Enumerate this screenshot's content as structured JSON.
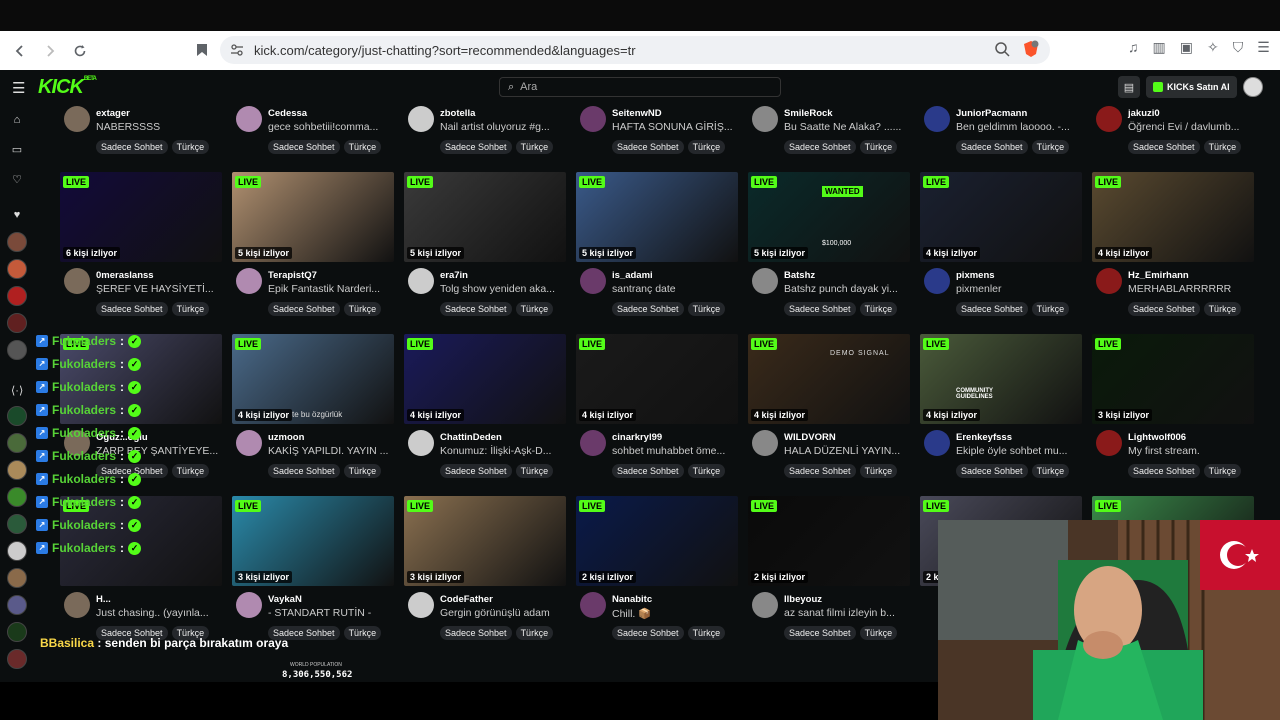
{
  "browser": {
    "url": "kick.com/category/just-chatting?sort=recommended&languages=tr",
    "back_icon": "arrow-left-icon",
    "forward_icon": "arrow-right-icon",
    "reload_icon": "reload-icon"
  },
  "header": {
    "logo": "KICK",
    "logo_badge": "BETA",
    "search_placeholder": "Ara",
    "buy_label": "KICKs Satın Al"
  },
  "tags": {
    "cat": "Sadece Sohbet",
    "lang": "Türkçe"
  },
  "live_label": "LIVE",
  "rows": [
    {
      "streams": [
        {
          "name": "extager",
          "title": "NABERSSSS",
          "viewers": ""
        },
        {
          "name": "Cedessa",
          "title": "gece sohbetiii!comma...",
          "viewers": ""
        },
        {
          "name": "zbotella",
          "title": "Nail artist oluyoruz #g...",
          "viewers": ""
        },
        {
          "name": "SeitenwND",
          "title": "HAFTA SONUNA GİRİŞ...",
          "viewers": ""
        },
        {
          "name": "SmileRock",
          "title": "Bu Saatte Ne Alaka? ......",
          "viewers": ""
        },
        {
          "name": "JuniorPacmann",
          "title": "Ben geldimm laoooo. -...",
          "viewers": ""
        },
        {
          "name": "jakuzi0",
          "title": "Öğrenci Evi / davlumb...",
          "viewers": ""
        }
      ]
    },
    {
      "streams": [
        {
          "name": "0meraslanss",
          "title": "ŞEREF VE HAYSİYETİ...",
          "viewers": "6 kişi izliyor"
        },
        {
          "name": "TerapistQ7",
          "title": "Epik Fantastik Narderi...",
          "viewers": "5 kişi izliyor"
        },
        {
          "name": "era7in",
          "title": "Tolg show yeniden aka...",
          "viewers": "5 kişi izliyor"
        },
        {
          "name": "is_adami",
          "title": "santranç date",
          "viewers": "5 kişi izliyor"
        },
        {
          "name": "Batshz",
          "title": "Batshz punch dayak yi...",
          "viewers": "5 kişi izliyor"
        },
        {
          "name": "pixmens",
          "title": "pixmenler",
          "viewers": "4 kişi izliyor"
        },
        {
          "name": "Hz_Emirhann",
          "title": "MERHABLARRRRRR",
          "viewers": "4 kişi izliyor"
        }
      ]
    },
    {
      "streams": [
        {
          "name": "Oguz...oglu",
          "title": "ZARP BEY ŞANTİYEYE...",
          "viewers": ""
        },
        {
          "name": "uzmoon",
          "title": "KAKİŞ YAPILDI. YAYIN ...",
          "viewers": "4 kişi izliyor"
        },
        {
          "name": "ChattinDeden",
          "title": "Konumuz: İlişki-Aşk-D...",
          "viewers": "4 kişi izliyor"
        },
        {
          "name": "cinarkryl99",
          "title": "sohbet muhabbet öme...",
          "viewers": "4 kişi izliyor"
        },
        {
          "name": "WILDVORN",
          "title": "HALA DÜZENLİ YAYIN...",
          "viewers": "4 kişi izliyor"
        },
        {
          "name": "Erenkeyfsss",
          "title": "Ekiple öyle sohbet mu...",
          "viewers": "4 kişi izliyor"
        },
        {
          "name": "Lightwolf006",
          "title": "My first stream.",
          "viewers": "3 kişi izliyor"
        }
      ]
    },
    {
      "streams": [
        {
          "name": "H...",
          "title": "Just chasing.. (yayınla...",
          "viewers": ""
        },
        {
          "name": "VaykaN",
          "title": "- STANDART RUTİN -",
          "viewers": "3 kişi izliyor"
        },
        {
          "name": "CodeFather",
          "title": "Gergin görünüşlü adam",
          "viewers": "3 kişi izliyor"
        },
        {
          "name": "Nanabitc",
          "title": "Chill. 📦",
          "viewers": "2 kişi izliyor"
        },
        {
          "name": "Ilbeyouz",
          "title": "az sanat filmi izleyin b...",
          "viewers": "2 kişi izliyor"
        },
        {
          "name": "",
          "title": "",
          "viewers": "2 k"
        },
        {
          "name": "",
          "title": "",
          "viewers": ""
        }
      ]
    }
  ],
  "chat": {
    "repeat_user": "Fukoladers",
    "colon": ":",
    "last_user": "BBasilica",
    "last_message": "senden bi parça bırakatım oraya"
  },
  "thumb_overlays": {
    "uzmoon_caption": "te bu özgürlük",
    "world_population_label": "WORLD POPULATION",
    "world_population_value": "8,306,550,562",
    "wanted_label": "WANTED",
    "wanted_value": "$100,000",
    "demo_label": "DEMO SIGNAL",
    "community_label": "COMMUNITY GUIDELINES"
  }
}
